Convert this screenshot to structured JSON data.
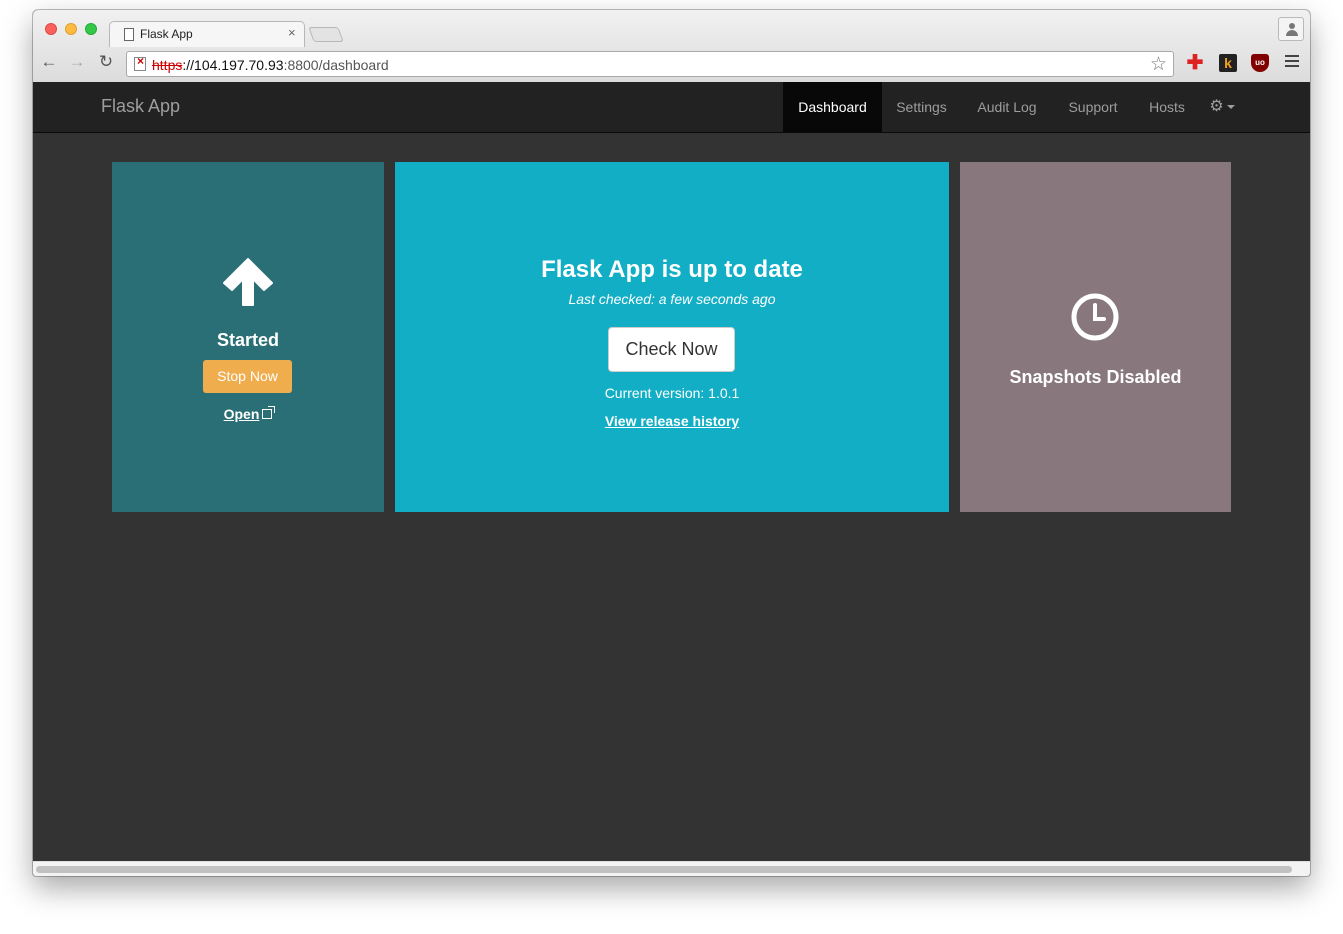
{
  "browser": {
    "tab_title": "Flask App",
    "tab_close": "×",
    "url_scheme": "https",
    "url_host": "://104.197.70.93",
    "url_rest": ":8800/dashboard",
    "icons": [
      "back-icon",
      "forward-icon",
      "reload-icon",
      "insecure-lock-icon",
      "star-icon",
      "profile-icon",
      "menu-icon"
    ],
    "extensions": {
      "k_label": "k",
      "ub_label": "uo"
    }
  },
  "navbar": {
    "brand": "Flask App",
    "items": [
      {
        "label": "Dashboard",
        "active": true
      },
      {
        "label": "Settings",
        "active": false
      },
      {
        "label": "Audit Log",
        "active": false
      },
      {
        "label": "Support",
        "active": false
      },
      {
        "label": "Hosts",
        "active": false
      }
    ],
    "gear_icon": "gear-icon"
  },
  "panels": {
    "status": {
      "icon": "arrow-up-icon",
      "label": "Started",
      "stop_button": "Stop Now",
      "open_link": "Open"
    },
    "update": {
      "title": "Flask App is up to date",
      "last_checked": "Last checked: a few seconds ago",
      "check_button": "Check Now",
      "current_version": "Current version: 1.0.1",
      "release_link": "View release history"
    },
    "snapshots": {
      "icon": "clock-icon",
      "label": "Snapshots Disabled"
    }
  },
  "colors": {
    "navbar_bg": "#222222",
    "page_bg": "#333333",
    "status_panel": "#2a6f75",
    "update_panel": "#12aec5",
    "snapshot_panel": "#88787d",
    "stop_button": "#f0ad4e"
  }
}
